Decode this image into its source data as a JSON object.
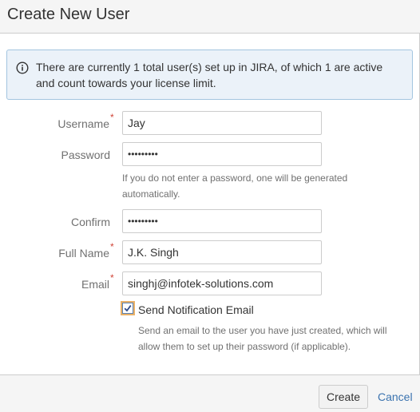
{
  "dialog": {
    "title": "Create New User"
  },
  "info": {
    "icon": "info-icon",
    "message": "There are currently 1 total user(s) set up in JIRA, of which 1 are active and count towards your license limit."
  },
  "form": {
    "required_marker": "*",
    "username": {
      "label": "Username",
      "value": "Jay",
      "required": true
    },
    "password": {
      "label": "Password",
      "value": "•••••••••",
      "help": "If you do not enter a password, one will be generated automatically."
    },
    "confirm": {
      "label": "Confirm",
      "value": "•••••••••"
    },
    "fullname": {
      "label": "Full Name",
      "value": "J.K. Singh",
      "required": true
    },
    "email": {
      "label": "Email",
      "value": "singhj@infotek-solutions.com",
      "required": true
    },
    "notification": {
      "label": "Send Notification Email",
      "checked": true,
      "help": "Send an email to the user you have just created, which will allow them to set up their password (if applicable)."
    }
  },
  "footer": {
    "create_label": "Create",
    "cancel_label": "Cancel"
  },
  "colors": {
    "required": "#d04437",
    "link": "#3b73af",
    "info_bg": "#ebf2f9",
    "info_border": "#a3c5e0"
  }
}
